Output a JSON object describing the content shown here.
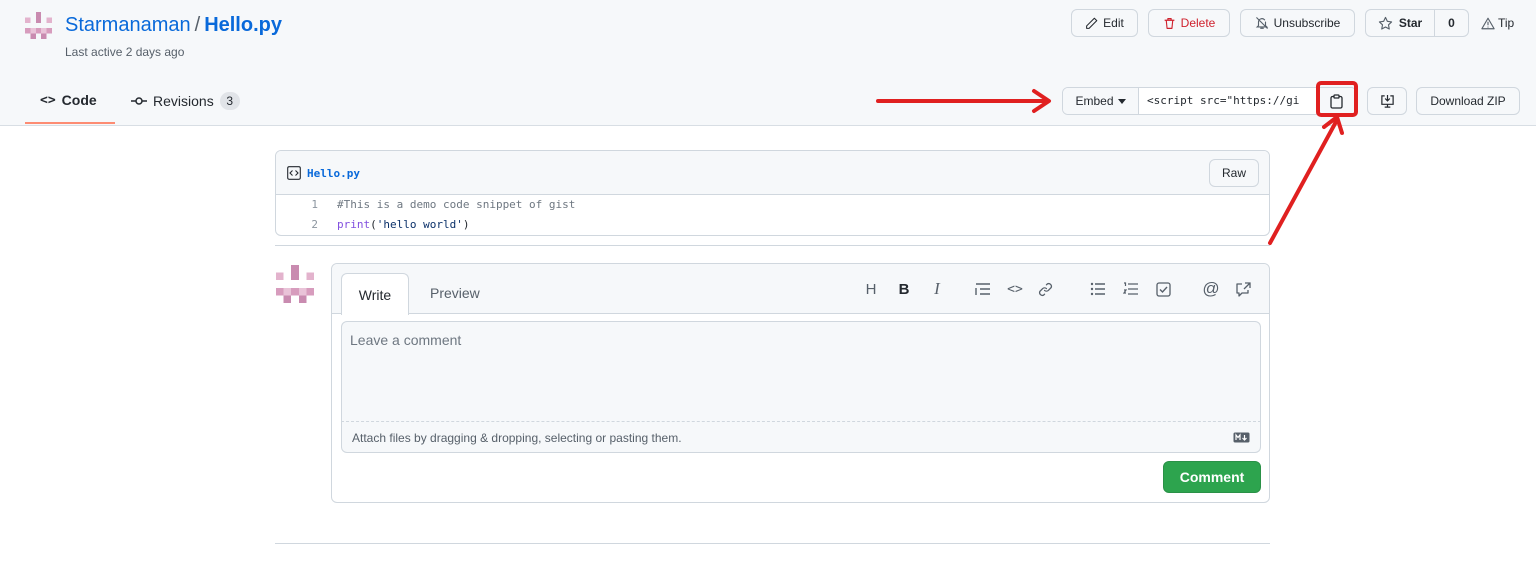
{
  "header": {
    "owner": "Starmanaman",
    "separator": "/",
    "filename": "Hello.py",
    "last_active": "Last active 2 days ago"
  },
  "actions": {
    "edit": "Edit",
    "delete": "Delete",
    "unsubscribe": "Unsubscribe",
    "star": "Star",
    "star_count": "0",
    "tip": "Tip"
  },
  "tabs": {
    "code": "Code",
    "revisions": "Revisions",
    "revisions_count": "3"
  },
  "embed": {
    "label": "Embed",
    "value": "<script src=\"https://gi"
  },
  "download_zip": "Download ZIP",
  "file": {
    "name": "Hello.py",
    "raw": "Raw",
    "lines": [
      {
        "number": "1",
        "parts": [
          "#This is a demo code snippet of gist"
        ]
      },
      {
        "number": "2",
        "parts": [
          "print",
          "(",
          "'hello world'",
          ")"
        ]
      }
    ]
  },
  "comment": {
    "write_tab": "Write",
    "preview_tab": "Preview",
    "toolbar": [
      "heading",
      "bold",
      "italic",
      "quote",
      "code",
      "link",
      "bulleted-list",
      "numbered-list",
      "task-list",
      "mention",
      "reference"
    ],
    "placeholder": "Leave a comment",
    "attach_hint": "Attach files by dragging & dropping, selecting or pasting them.",
    "submit": "Comment"
  },
  "colors": {
    "link": "#0969da",
    "danger": "#cf222e",
    "success": "#2da44e",
    "annotation": "#e02020",
    "tab_underline": "#fd8c73"
  }
}
